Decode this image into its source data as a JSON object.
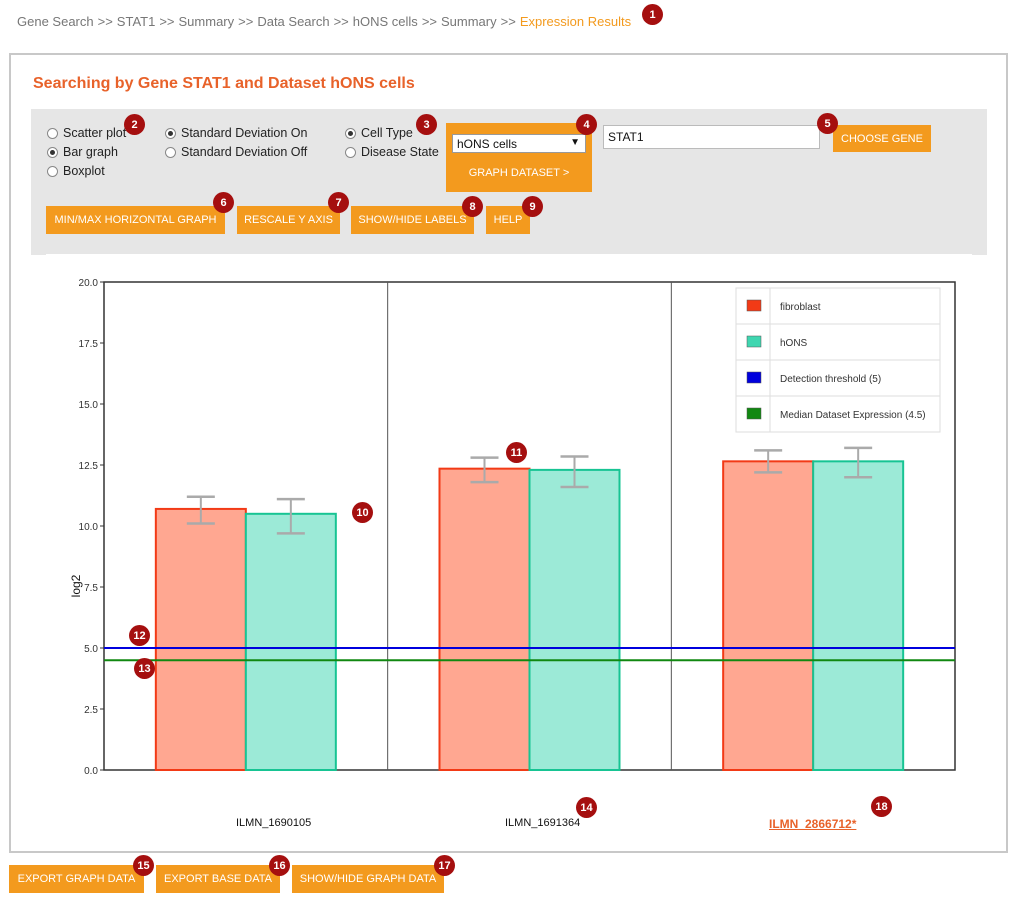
{
  "breadcrumb": [
    "Gene Search",
    "STAT1",
    "Summary",
    "Data Search",
    "hONS cells",
    "Summary",
    "Expression Results"
  ],
  "breadcrumb_sep": ">>",
  "title": "Searching by Gene STAT1 and Dataset hONS cells",
  "graph_type": {
    "options": [
      "Scatter plot",
      "Bar graph",
      "Boxplot"
    ],
    "selected": "Bar graph"
  },
  "std_dev": {
    "options": [
      "Standard Deviation On",
      "Standard Deviation Off"
    ],
    "selected": "Standard Deviation On"
  },
  "group_by": {
    "options": [
      "Cell Type",
      "Disease State"
    ],
    "selected": "Cell Type"
  },
  "dataset_select": {
    "value": "hONS cells"
  },
  "graph_dataset_label": "GRAPH DATASET >",
  "gene_input": {
    "value": "STAT1"
  },
  "choose_gene_label": "CHOOSE GENE",
  "toolbar": {
    "minmax_label": "MIN/MAX HORIZONTAL GRAPH",
    "rescale_label": "RESCALE Y AXIS",
    "showhide_labels_label": "SHOW/HIDE LABELS",
    "help_label": "HELP"
  },
  "export": {
    "graph_label": "EXPORT GRAPH DATA",
    "base_label": "EXPORT BASE DATA",
    "showhide_graph_label": "SHOW/HIDE GRAPH DATA"
  },
  "badges": [
    "1",
    "2",
    "3",
    "4",
    "5",
    "6",
    "7",
    "8",
    "9",
    "10",
    "11",
    "12",
    "13",
    "14",
    "15",
    "16",
    "17",
    "18"
  ],
  "colors": {
    "accent": "#f39a1e",
    "title": "#e8622a",
    "badge": "#a50f0f",
    "fibroblast_fill": "#ffa791",
    "fibroblast_stroke": "#f23a16",
    "hons_fill": "#9cead7",
    "hons_stroke": "#17c493",
    "threshold": "#0000dd",
    "median": "#118811"
  },
  "chart_data": {
    "type": "bar",
    "ylabel": "log2",
    "ylim": [
      0,
      20
    ],
    "yticks": [
      "0.0",
      "2.5",
      "5.0",
      "7.5",
      "10.0",
      "12.5",
      "15.0",
      "17.5",
      "20.0"
    ],
    "categories": [
      "ILMN_1690105",
      "ILMN_1691364",
      "ILMN_2866712*"
    ],
    "series": [
      {
        "name": "fibroblast",
        "values": [
          10.7,
          12.35,
          12.65
        ],
        "sd_low": [
          10.1,
          11.8,
          12.2
        ],
        "sd_high": [
          11.2,
          12.8,
          13.1
        ]
      },
      {
        "name": "hONS",
        "values": [
          10.5,
          12.3,
          12.65
        ],
        "sd_low": [
          9.7,
          11.6,
          12.0
        ],
        "sd_high": [
          11.1,
          12.85,
          13.2
        ]
      }
    ],
    "lines": [
      {
        "name": "Detection threshold (5)",
        "value": 5
      },
      {
        "name": "Median Dataset Expression (4.5)",
        "value": 4.5
      }
    ],
    "legend": [
      "fibroblast",
      "hONS",
      "Detection threshold (5)",
      "Median Dataset Expression (4.5)"
    ],
    "legend_position": "top-right",
    "grid": false
  }
}
